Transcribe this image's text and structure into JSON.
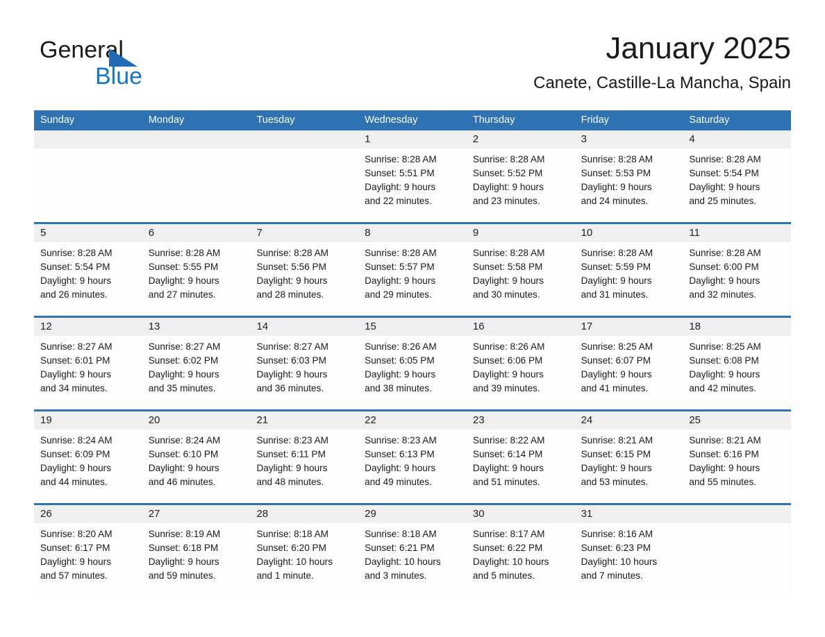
{
  "brand": {
    "line1": "General",
    "line2": "Blue",
    "mark": "triangle-logo",
    "accent_color": "#1476c4",
    "mark_color": "#1f6cb4"
  },
  "header": {
    "month_title": "January 2025",
    "location": "Canete, Castille-La Mancha, Spain"
  },
  "calendar": {
    "header_color": "#2e72b4",
    "weekdays": [
      "Sunday",
      "Monday",
      "Tuesday",
      "Wednesday",
      "Thursday",
      "Friday",
      "Saturday"
    ],
    "weeks": [
      [
        {
          "day": "",
          "lines": []
        },
        {
          "day": "",
          "lines": []
        },
        {
          "day": "",
          "lines": []
        },
        {
          "day": "1",
          "lines": [
            "Sunrise: 8:28 AM",
            "Sunset: 5:51 PM",
            "Daylight: 9 hours",
            "and 22 minutes."
          ]
        },
        {
          "day": "2",
          "lines": [
            "Sunrise: 8:28 AM",
            "Sunset: 5:52 PM",
            "Daylight: 9 hours",
            "and 23 minutes."
          ]
        },
        {
          "day": "3",
          "lines": [
            "Sunrise: 8:28 AM",
            "Sunset: 5:53 PM",
            "Daylight: 9 hours",
            "and 24 minutes."
          ]
        },
        {
          "day": "4",
          "lines": [
            "Sunrise: 8:28 AM",
            "Sunset: 5:54 PM",
            "Daylight: 9 hours",
            "and 25 minutes."
          ]
        }
      ],
      [
        {
          "day": "5",
          "lines": [
            "Sunrise: 8:28 AM",
            "Sunset: 5:54 PM",
            "Daylight: 9 hours",
            "and 26 minutes."
          ]
        },
        {
          "day": "6",
          "lines": [
            "Sunrise: 8:28 AM",
            "Sunset: 5:55 PM",
            "Daylight: 9 hours",
            "and 27 minutes."
          ]
        },
        {
          "day": "7",
          "lines": [
            "Sunrise: 8:28 AM",
            "Sunset: 5:56 PM",
            "Daylight: 9 hours",
            "and 28 minutes."
          ]
        },
        {
          "day": "8",
          "lines": [
            "Sunrise: 8:28 AM",
            "Sunset: 5:57 PM",
            "Daylight: 9 hours",
            "and 29 minutes."
          ]
        },
        {
          "day": "9",
          "lines": [
            "Sunrise: 8:28 AM",
            "Sunset: 5:58 PM",
            "Daylight: 9 hours",
            "and 30 minutes."
          ]
        },
        {
          "day": "10",
          "lines": [
            "Sunrise: 8:28 AM",
            "Sunset: 5:59 PM",
            "Daylight: 9 hours",
            "and 31 minutes."
          ]
        },
        {
          "day": "11",
          "lines": [
            "Sunrise: 8:28 AM",
            "Sunset: 6:00 PM",
            "Daylight: 9 hours",
            "and 32 minutes."
          ]
        }
      ],
      [
        {
          "day": "12",
          "lines": [
            "Sunrise: 8:27 AM",
            "Sunset: 6:01 PM",
            "Daylight: 9 hours",
            "and 34 minutes."
          ]
        },
        {
          "day": "13",
          "lines": [
            "Sunrise: 8:27 AM",
            "Sunset: 6:02 PM",
            "Daylight: 9 hours",
            "and 35 minutes."
          ]
        },
        {
          "day": "14",
          "lines": [
            "Sunrise: 8:27 AM",
            "Sunset: 6:03 PM",
            "Daylight: 9 hours",
            "and 36 minutes."
          ]
        },
        {
          "day": "15",
          "lines": [
            "Sunrise: 8:26 AM",
            "Sunset: 6:05 PM",
            "Daylight: 9 hours",
            "and 38 minutes."
          ]
        },
        {
          "day": "16",
          "lines": [
            "Sunrise: 8:26 AM",
            "Sunset: 6:06 PM",
            "Daylight: 9 hours",
            "and 39 minutes."
          ]
        },
        {
          "day": "17",
          "lines": [
            "Sunrise: 8:25 AM",
            "Sunset: 6:07 PM",
            "Daylight: 9 hours",
            "and 41 minutes."
          ]
        },
        {
          "day": "18",
          "lines": [
            "Sunrise: 8:25 AM",
            "Sunset: 6:08 PM",
            "Daylight: 9 hours",
            "and 42 minutes."
          ]
        }
      ],
      [
        {
          "day": "19",
          "lines": [
            "Sunrise: 8:24 AM",
            "Sunset: 6:09 PM",
            "Daylight: 9 hours",
            "and 44 minutes."
          ]
        },
        {
          "day": "20",
          "lines": [
            "Sunrise: 8:24 AM",
            "Sunset: 6:10 PM",
            "Daylight: 9 hours",
            "and 46 minutes."
          ]
        },
        {
          "day": "21",
          "lines": [
            "Sunrise: 8:23 AM",
            "Sunset: 6:11 PM",
            "Daylight: 9 hours",
            "and 48 minutes."
          ]
        },
        {
          "day": "22",
          "lines": [
            "Sunrise: 8:23 AM",
            "Sunset: 6:13 PM",
            "Daylight: 9 hours",
            "and 49 minutes."
          ]
        },
        {
          "day": "23",
          "lines": [
            "Sunrise: 8:22 AM",
            "Sunset: 6:14 PM",
            "Daylight: 9 hours",
            "and 51 minutes."
          ]
        },
        {
          "day": "24",
          "lines": [
            "Sunrise: 8:21 AM",
            "Sunset: 6:15 PM",
            "Daylight: 9 hours",
            "and 53 minutes."
          ]
        },
        {
          "day": "25",
          "lines": [
            "Sunrise: 8:21 AM",
            "Sunset: 6:16 PM",
            "Daylight: 9 hours",
            "and 55 minutes."
          ]
        }
      ],
      [
        {
          "day": "26",
          "lines": [
            "Sunrise: 8:20 AM",
            "Sunset: 6:17 PM",
            "Daylight: 9 hours",
            "and 57 minutes."
          ]
        },
        {
          "day": "27",
          "lines": [
            "Sunrise: 8:19 AM",
            "Sunset: 6:18 PM",
            "Daylight: 9 hours",
            "and 59 minutes."
          ]
        },
        {
          "day": "28",
          "lines": [
            "Sunrise: 8:18 AM",
            "Sunset: 6:20 PM",
            "Daylight: 10 hours",
            "and 1 minute."
          ]
        },
        {
          "day": "29",
          "lines": [
            "Sunrise: 8:18 AM",
            "Sunset: 6:21 PM",
            "Daylight: 10 hours",
            "and 3 minutes."
          ]
        },
        {
          "day": "30",
          "lines": [
            "Sunrise: 8:17 AM",
            "Sunset: 6:22 PM",
            "Daylight: 10 hours",
            "and 5 minutes."
          ]
        },
        {
          "day": "31",
          "lines": [
            "Sunrise: 8:16 AM",
            "Sunset: 6:23 PM",
            "Daylight: 10 hours",
            "and 7 minutes."
          ]
        },
        {
          "day": "",
          "lines": []
        }
      ]
    ]
  }
}
